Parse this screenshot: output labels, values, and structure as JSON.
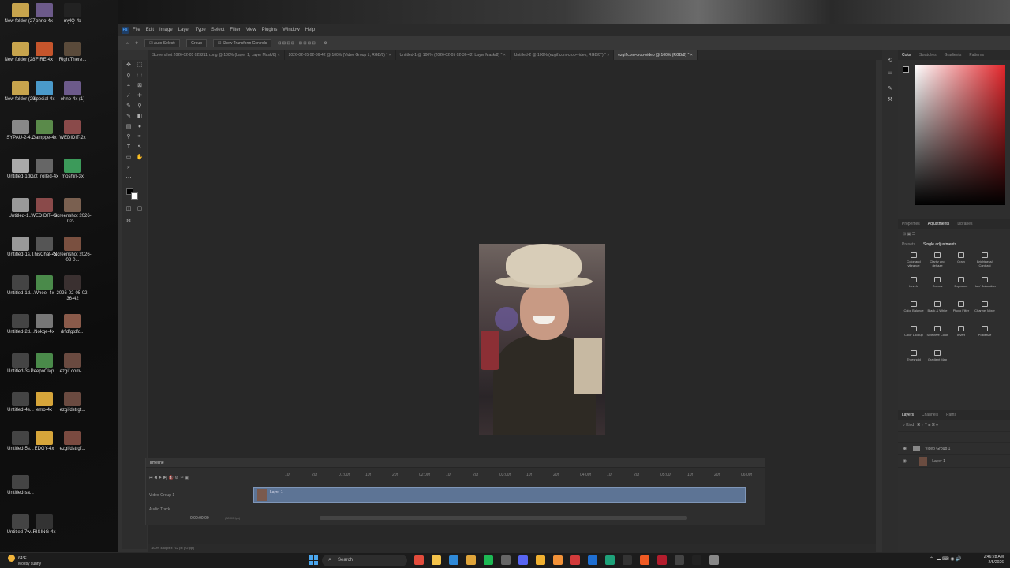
{
  "desktop": {
    "icons": [
      {
        "label": "New folder (27)",
        "color": "#c7a44d"
      },
      {
        "label": "ohno-4x",
        "color": "#6c5a8a"
      },
      {
        "label": "mylQ-4x",
        "color": "#222"
      },
      {
        "label": "New folder (28)",
        "color": "#c7a44d"
      },
      {
        "label": "FIRE-4x",
        "color": "#c5552c"
      },
      {
        "label": "RightThere...",
        "color": "#5a4a3a"
      },
      {
        "label": "New folder (29)",
        "color": "#c7a44d"
      },
      {
        "label": "special-4x",
        "color": "#4a9aca"
      },
      {
        "label": "ohno-4x (1)",
        "color": "#6c5a8a"
      },
      {
        "label": "SYPAU-2-4...",
        "color": "#888"
      },
      {
        "label": "Gampge-4x",
        "color": "#5a8a4a"
      },
      {
        "label": "WEDIDIT-2x",
        "color": "#8a4a4a"
      },
      {
        "label": "Untitled-1d...",
        "color": "#aaa"
      },
      {
        "label": "GotTrolled-4x",
        "color": "#666"
      },
      {
        "label": "moshin-3x",
        "color": "#3c9a5a"
      },
      {
        "label": "Untitled-1...",
        "color": "#999"
      },
      {
        "label": "WEDIDIT-4x",
        "color": "#8a4a4a"
      },
      {
        "label": "Screenshot 2026-02-...",
        "color": "#7a6050"
      },
      {
        "label": "Untitled-1s...",
        "color": "#999"
      },
      {
        "label": "ThisChat-4x",
        "color": "#555"
      },
      {
        "label": "Screenshot 2026-02-0...",
        "color": "#7a5040"
      },
      {
        "label": "Untitled-1d...",
        "color": "#444"
      },
      {
        "label": "Wheel-4x",
        "color": "#4a8a4a"
      },
      {
        "label": "2026-02-05 02-36-42",
        "color": "#3a3030"
      },
      {
        "label": "Untitled-2d...",
        "color": "#444"
      },
      {
        "label": "Nokge-4x",
        "color": "#777"
      },
      {
        "label": "drfdfgtdfd...",
        "color": "#8a5a4a"
      },
      {
        "label": "Untitled-3s...",
        "color": "#444"
      },
      {
        "label": "PeepoClap...",
        "color": "#4a8a4a"
      },
      {
        "label": "ezgif.com-...",
        "color": "#6a4a40"
      },
      {
        "label": "Untitled-4s...",
        "color": "#444"
      },
      {
        "label": "emo-4x",
        "color": "#d6a53a"
      },
      {
        "label": "ezgifdstrgt...",
        "color": "#6a4a40"
      },
      {
        "label": "Untitled-5s...",
        "color": "#444"
      },
      {
        "label": "EDGY-4x",
        "color": "#d6a53a"
      },
      {
        "label": "ezgifdstrgf...",
        "color": "#7a4a40"
      },
      {
        "label": "Untitled-sa...",
        "color": "#444"
      },
      {
        "label": "Untitled-7w...",
        "color": "#444"
      },
      {
        "label": "RISING-4x",
        "color": "#333"
      }
    ]
  },
  "ps": {
    "menu": [
      "File",
      "Edit",
      "Image",
      "Layer",
      "Type",
      "Select",
      "Filter",
      "View",
      "Plugins",
      "Window",
      "Help"
    ],
    "options": {
      "auto_select": "Auto-Select:",
      "group": "Group",
      "show_transform": "Show Transform Controls"
    },
    "tabs": [
      "Screenshot 2026-02-05 023211h.png @ 100% (Layer 1, Layer Mask/8) ×",
      "2026-02-05 02-36-42 @ 100% (Video Group 1, RGB/8) * ×",
      "Untitled-1 @ 100% (2026-02-05 02-36-42, Layer Mask/8) * ×",
      "Untitled-2 @ 100% (ezgif.com-crop-video, RGB/8*) * ×",
      "ezgif.com-crop-video @ 100% (RGB/8) * ×"
    ],
    "timeline": {
      "title": "Timeline",
      "group": "Video Group 1",
      "clip": "Layer 1",
      "audio": "Audio Track",
      "time": "0:00:00:00",
      "fps": "(30.00 fps)",
      "ruler": [
        "10f",
        "20f",
        "01:00f",
        "10f",
        "20f",
        "02:00f",
        "10f",
        "20f",
        "03:00f",
        "10f",
        "20f",
        "04:00f",
        "10f",
        "20f",
        "05:00f",
        "10f",
        "20f",
        "06:00f"
      ]
    },
    "status": "100%     480 px x 712 px (72 ppi)",
    "right": {
      "color_tabs": [
        "Color",
        "Swatches",
        "Gradients",
        "Patterns"
      ],
      "adj_tabs": [
        "Properties",
        "Adjustments",
        "Libraries"
      ],
      "adj_subtabs": [
        "Presets",
        "Single adjustments"
      ],
      "adjustments": [
        "Color and vibrance",
        "Clarity and dehaze",
        "Grain",
        "Brightness/ Contrast",
        "Levels",
        "Curves",
        "Exposure",
        "Hue/ Saturation",
        "Color Balance",
        "Black & White",
        "Photo Filter",
        "Channel Mixer",
        "Color Lookup",
        "Selective Color",
        "Invert",
        "Posterize",
        "Threshold",
        "Gradient Map"
      ],
      "layer_tabs": [
        "Layers",
        "Channels",
        "Paths"
      ],
      "layer_search": "Kind",
      "layers": [
        {
          "name": "Video Group 1",
          "type": "group"
        },
        {
          "name": "Layer 1",
          "type": "layer"
        }
      ]
    }
  },
  "taskbar": {
    "weather_temp": "64°F",
    "weather_desc": "Mostly sunny",
    "search": "Search",
    "time": "2:46:28 AM",
    "date": "2/5/2026",
    "apps": [
      {
        "name": "chrome",
        "color": "#e34c3c"
      },
      {
        "name": "file-explorer",
        "color": "#f3c24a"
      },
      {
        "name": "edge",
        "color": "#2f8ad8"
      },
      {
        "name": "folder",
        "color": "#e0a53a"
      },
      {
        "name": "spotify",
        "color": "#1db954"
      },
      {
        "name": "obs",
        "color": "#666"
      },
      {
        "name": "discord",
        "color": "#5865f2"
      },
      {
        "name": "bookmark",
        "color": "#f0b030"
      },
      {
        "name": "illustrator",
        "color": "#f39238"
      },
      {
        "name": "app-red",
        "color": "#d23b3b"
      },
      {
        "name": "photoshop",
        "color": "#1f6fd2"
      },
      {
        "name": "app-green",
        "color": "#1ea27a"
      },
      {
        "name": "terminal",
        "color": "#333"
      },
      {
        "name": "brave",
        "color": "#ef5a23"
      },
      {
        "name": "app-red2",
        "color": "#b31d2d"
      },
      {
        "name": "app-grey",
        "color": "#444"
      },
      {
        "name": "app-dark",
        "color": "#222"
      },
      {
        "name": "app-light",
        "color": "#888"
      }
    ]
  }
}
